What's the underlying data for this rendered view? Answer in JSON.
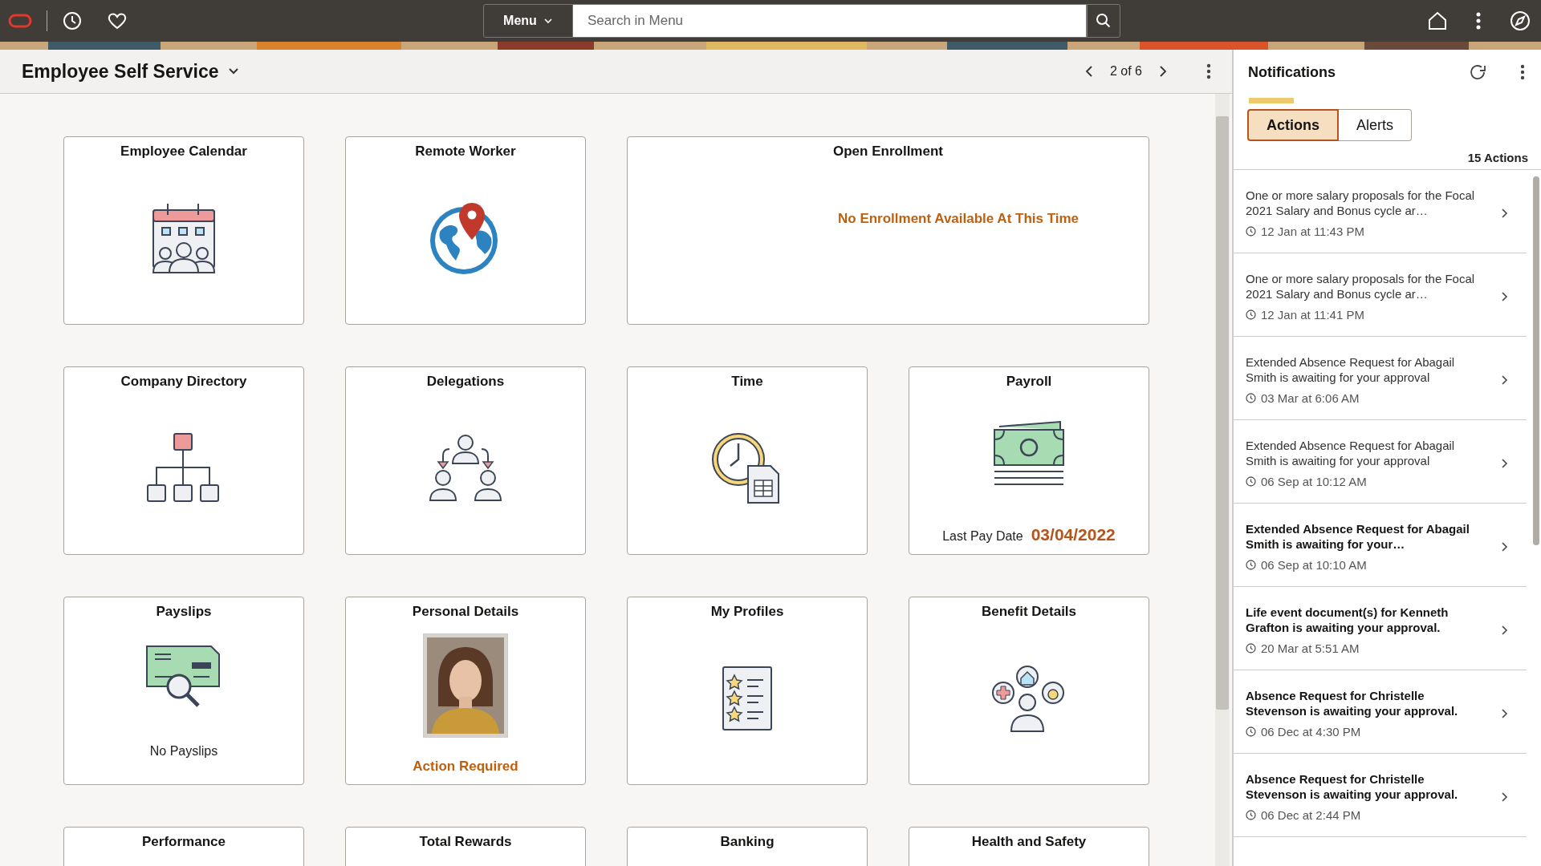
{
  "top_bar": {
    "menu_button": "Menu",
    "search": {
      "placeholder": "Search in Menu"
    }
  },
  "header": {
    "title": "Employee Self Service",
    "pager": "2 of 6"
  },
  "tiles": [
    {
      "title": "Employee Calendar",
      "kind": "calendar",
      "wide": false
    },
    {
      "title": "Remote Worker",
      "kind": "globe",
      "wide": false
    },
    {
      "title": "Open Enrollment",
      "kind": "none",
      "wide": true,
      "footer": {
        "kind": "message",
        "text": "No Enrollment Available At This Time"
      }
    },
    {
      "title": "Company Directory",
      "kind": "org",
      "wide": false
    },
    {
      "title": "Delegations",
      "kind": "delegate",
      "wide": false
    },
    {
      "title": "Time",
      "kind": "clock",
      "wide": false
    },
    {
      "title": "Payroll",
      "kind": "money",
      "wide": false,
      "footer": {
        "kind": "labeled",
        "label": "Last Pay Date",
        "text": "03/04/2022"
      }
    },
    {
      "title": "Payslips",
      "kind": "payslip",
      "wide": false,
      "footer": {
        "kind": "plain",
        "text": "No Payslips"
      }
    },
    {
      "title": "Personal Details",
      "wide": false,
      "footer": {
        "kind": "alert",
        "text": "Action Required"
      }
    },
    {
      "title": "My Profiles",
      "kind": "profile",
      "wide": false
    },
    {
      "title": "Benefit Details",
      "kind": "benefit",
      "wide": false
    },
    {
      "title": "Performance",
      "kind": "none",
      "wide": false
    },
    {
      "title": "Total Rewards",
      "kind": "none",
      "wide": false
    },
    {
      "title": "Banking",
      "kind": "none",
      "wide": false
    },
    {
      "title": "Health and Safety",
      "kind": "none",
      "wide": false
    }
  ],
  "notifications": {
    "title": "Notifications",
    "tabs": [
      {
        "label": "Actions",
        "selected": true
      },
      {
        "label": "Alerts",
        "selected": false
      }
    ],
    "count": "15 Actions",
    "items": [
      {
        "text": "One or more salary proposals for the Focal 2021 Salary and Bonus cycle ar…",
        "time": "12 Jan at 11:43 PM",
        "unread": false
      },
      {
        "text": "One or more salary proposals for the Focal 2021 Salary and Bonus cycle ar…",
        "time": "12 Jan at 11:41 PM",
        "unread": false
      },
      {
        "text": "Extended Absence Request for Abagail Smith is awaiting for your approval",
        "time": "03 Mar at 6:06 AM",
        "unread": false
      },
      {
        "text": "Extended Absence Request for Abagail Smith is awaiting for your approval",
        "time": "06 Sep at 10:12 AM",
        "unread": false
      },
      {
        "text": "Extended Absence Request for Abagail Smith is awaiting for your…",
        "time": "06 Sep at 10:10 AM",
        "unread": true
      },
      {
        "text": "Life event document(s) for Kenneth Grafton is awaiting your approval.",
        "time": "20 Mar at 5:51 AM",
        "unread": true
      },
      {
        "text": "Absence Request for Christelle Stevenson is awaiting your approval.",
        "time": "06 Dec at 4:30 PM",
        "unread": true
      },
      {
        "text": "Absence Request for Christelle Stevenson is awaiting your approval.",
        "time": "06 Dec at 2:44 PM",
        "unread": true
      }
    ]
  }
}
